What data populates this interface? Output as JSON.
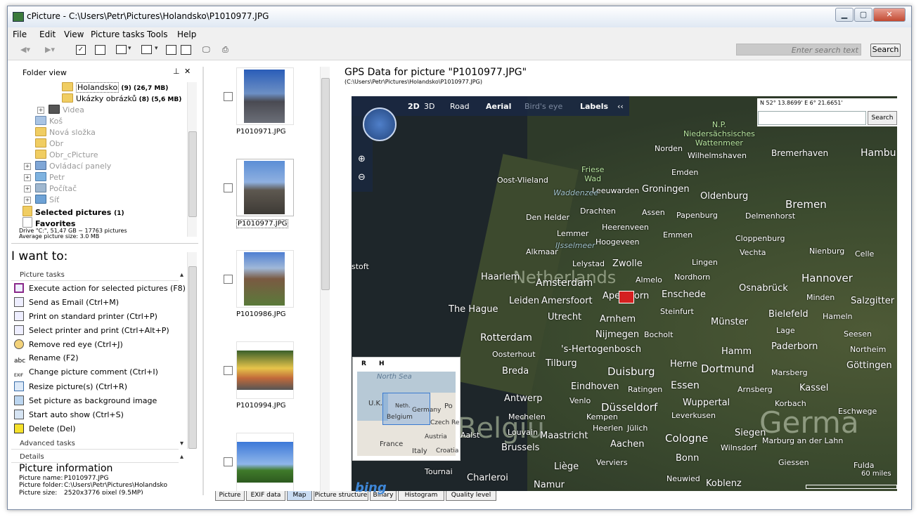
{
  "window": {
    "title": "cPicture - C:\\Users\\Petr\\Pictures\\Holandsko\\P1010977.JPG",
    "controls": {
      "minimize": "▁",
      "maximize": "▢",
      "close": "✕"
    }
  },
  "menu": [
    "File",
    "Edit",
    "View",
    "Picture tasks",
    "Tools",
    "Help"
  ],
  "toolbar": {
    "search_placeholder": "Enter search text",
    "search_button": "Search"
  },
  "folder_view": {
    "title": "Folder view",
    "items": [
      {
        "name": "Holandsko",
        "count": " (9) (26,7 MB)"
      },
      {
        "name": "Ukázky obrázků",
        "count": " (8) (5,6 MB)"
      },
      {
        "name": "Videa",
        "count": ""
      },
      {
        "name": "Koš",
        "count": ""
      },
      {
        "name": "Nová složka",
        "count": ""
      },
      {
        "name": "Obr",
        "count": ""
      },
      {
        "name": "Obr_cPicture",
        "count": ""
      },
      {
        "name": "Ovládací panely",
        "count": ""
      },
      {
        "name": "Petr",
        "count": ""
      },
      {
        "name": "Počítač",
        "count": ""
      },
      {
        "name": "Síť",
        "count": ""
      }
    ],
    "selected_pictures": "Selected pictures",
    "selected_count": "(1)",
    "favorites": "Favorites",
    "drive_info": "Drive \"C:\", 51,47 GB ~ 17763 pictures",
    "avg_size": "Average picture size: 3.0 MB"
  },
  "tasks": {
    "heading": "I want to:",
    "section": "Picture tasks",
    "items": [
      "Execute action for selected pictures (F8)",
      "Send as Email (Ctrl+M)",
      "Print on standard printer (Ctrl+P)",
      "Select printer and print (Ctrl+Alt+P)",
      "Remove red eye (Ctrl+J)",
      "Rename (F2)",
      "Change picture comment (Ctrl+I)",
      "Resize picture(s) (Ctrl+R)",
      "Set picture as background image",
      "Start auto show (Ctrl+S)",
      "Delete (Del)"
    ],
    "advanced": "Advanced tasks",
    "details": "Details"
  },
  "picture_info": {
    "title": "Picture information",
    "name_label": "Picture name:",
    "name": "P1010977.JPG",
    "folder_label": "Picture folder:",
    "folder": "C:\\Users\\Petr\\Pictures\\Holandsko",
    "size_label": "Picture size:",
    "size": "2520x3776 pixel (9.5MP)"
  },
  "thumbnails": [
    "P1010971.JPG",
    "P1010977.JPG",
    "P1010986.JPG",
    "P1010994.JPG",
    ""
  ],
  "tabs": [
    "Picture",
    "EXIF data",
    "Map",
    "Picture structure",
    "Binary",
    "Histogram",
    "Quality level"
  ],
  "gps": {
    "title": "GPS Data for picture \"P1010977.JPG\"",
    "path": "(C:\\Users\\Petr\\Pictures\\Holandsko\\P1010977.JPG)",
    "coords": "N 52° 13.8699' E 6° 21.6651'",
    "search": "Search"
  },
  "map_nav": {
    "d2": "2D",
    "d3": "3D",
    "road": "Road",
    "aerial": "Aerial",
    "birdseye": "Bird's eye",
    "labels": "Labels",
    "collapse": "‹‹"
  },
  "map_labels": {
    "netherlands": "Netherlands",
    "germany": "Germa",
    "belgium": "Belgiu",
    "amsterdam": "Amsterdam",
    "rotterdam": "Rotterdam",
    "hague": "The Hague",
    "haarlem": "Haarlem",
    "utrecht": "Utrecht",
    "leiden": "Leiden",
    "amersfoort": "Amersfoort",
    "apeldoorn": "Apeldoorn",
    "zwolle": "Zwolle",
    "groningen": "Groningen",
    "leeuwarden": "Leeuwarden",
    "enschede": "Enschede",
    "arnhem": "Arnhem",
    "nijmegen": "Nijmegen",
    "hertogenbosch": "'s-Hertogenbosch",
    "tilburg": "Tilburg",
    "breda": "Breda",
    "eindhoven": "Eindhoven",
    "antwerp": "Antwerp",
    "brussels": "Brussels",
    "liege": "Liège",
    "namur": "Namur",
    "charleroi": "Charleroi",
    "maastricht": "Maastricht",
    "aachen": "Aachen",
    "cologne": "Cologne",
    "bonn": "Bonn",
    "dusseldorf": "Düsseldorf",
    "duisburg": "Duisburg",
    "essen": "Essen",
    "dortmund": "Dortmund",
    "munster": "Münster",
    "osnabruck": "Osnabrück",
    "bremen": "Bremen",
    "oldenburg": "Oldenburg",
    "hannover": "Hannover",
    "bielefeld": "Bielefeld",
    "paderborn": "Paderborn",
    "hamm": "Hamm",
    "kassel": "Kassel",
    "wuppertal": "Wuppertal",
    "leverkusen": "Leverkusen",
    "siegen": "Siegen",
    "emden": "Emden",
    "norden": "Norden",
    "wilhelmshaven": "Wilhelmshaven",
    "bremerhaven": "Bremerhaven",
    "hamburg": "Hambu",
    "oostvlieland": "Oost-Vlieland",
    "denhelder": "Den Helder",
    "alkmaar": "Alkmaar",
    "drachten": "Drachten",
    "heerenveen": "Heerenveen",
    "assen": "Assen",
    "emmen": "Emmen",
    "papenburg": "Papenburg",
    "lingen": "Lingen",
    "nordhorn": "Nordhorn",
    "almelo": "Almelo",
    "steinfurt": "Steinfurt",
    "wadden": "Waddenzee",
    "friesewad": "Friese\nWad",
    "ijssel": "IJsselmeer",
    "niedersachs": "N.P.\nNiedersächsisches\nWattenmeer",
    "stoft": "stoft",
    "lelystad": "Lelystad",
    "hoogeveen": "Hoogeveen",
    "lemmer": "Lemmer",
    "cloppenburg": "Cloppenburg",
    "vechta": "Vechta",
    "delmenhorst": "Delmenhorst",
    "nienburg": "Nienburg",
    "minden": "Minden",
    "hameln": "Hameln",
    "salzgitter": "Salzgitter",
    "celle": "Celle",
    "lage": "Lage",
    "seesen": "Seesen",
    "northeim": "Northeim",
    "gottingen": "Göttingen",
    "marsberg": "Marsberg",
    "korbach": "Korbach",
    "eschwege": "Eschwege",
    "arnsberg": "Arnsberg",
    "marburg": "Marburg an der Lahn",
    "giessen": "Giessen",
    "fulda": "Fulda",
    "wilnsdorf": "Wilnsdorf",
    "neuwied": "Neuwied",
    "koblenz": "Koblenz",
    "verviers": "Verviers",
    "heerlen": "Heerlen",
    "julich": "Jülich",
    "mechelen": "Mechelen",
    "leuven": "Louvain",
    "aalst": "Aalst",
    "tournai": "Tournai",
    "roosendaal": "Oosterhout",
    "venlo": "Venlo",
    "kempen": "Kempen",
    "ratingen": "Ratingen",
    "bocholt": "Bocholt",
    "herne": "Herne",
    "scale": "60 miles"
  },
  "minimap": {
    "r": "R",
    "h": "H",
    "northsea": "North Sea",
    "uk": "U.K.",
    "neth": "Neth.",
    "germany": "Germany",
    "belgium": "Belgium",
    "france": "France",
    "austria": "Austria",
    "italy": "Italy",
    "czech": "Czech Re",
    "poland": "Po",
    "croatia": "Croatia"
  }
}
